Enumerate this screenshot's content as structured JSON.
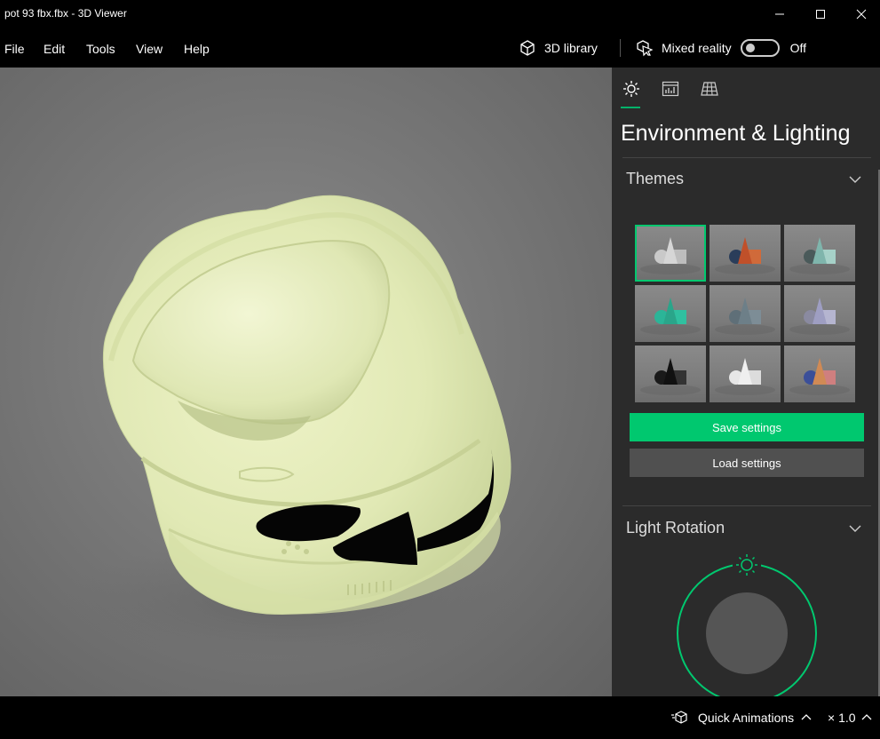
{
  "window": {
    "title": "pot 93 fbx.fbx - 3D Viewer"
  },
  "menu": {
    "items": [
      "File",
      "Edit",
      "Tools",
      "View",
      "Help"
    ]
  },
  "toolbar": {
    "library_label": "3D library",
    "mixed_reality_label": "Mixed reality",
    "mixed_reality_state": "Off",
    "mixed_reality_on": false
  },
  "panel": {
    "tabs": [
      {
        "icon": "sun-icon",
        "selected": true
      },
      {
        "icon": "stats-icon",
        "selected": false
      },
      {
        "icon": "grid-icon",
        "selected": false
      }
    ],
    "title": "Environment & Lighting",
    "themes": {
      "heading": "Themes",
      "selected_index": 0,
      "count": 9
    },
    "save_label": "Save settings",
    "load_label": "Load settings",
    "light_rotation": {
      "heading": "Light Rotation"
    }
  },
  "statusbar": {
    "quick_animations_label": "Quick Animations",
    "speed_label": "× 1.0"
  },
  "colors": {
    "accent": "#00c86f",
    "panel_bg": "#2b2b2b",
    "model": "#e3ebba"
  }
}
